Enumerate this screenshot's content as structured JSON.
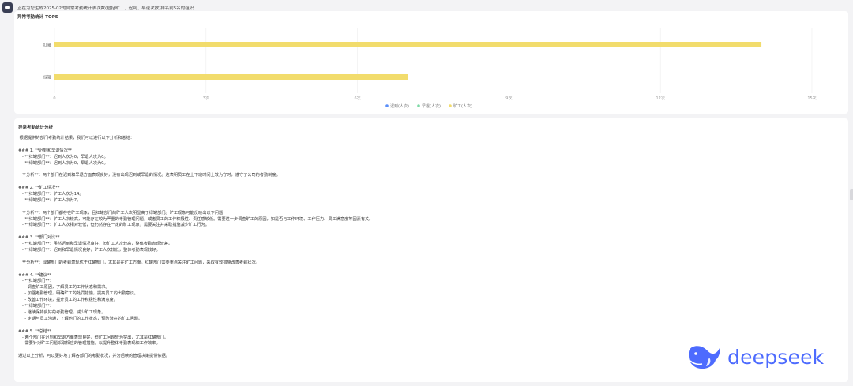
{
  "status": {
    "icon": "bot-eye-icon",
    "text": "正在为您生成2025-02的异常考勤统计表次数(包括旷工、迟到、早退次数)排名前5名的组织..."
  },
  "chart_data": {
    "type": "bar",
    "orientation": "horizontal",
    "title": "异常考勤统计-TOP5",
    "categories": [
      "红罐",
      "绿罐"
    ],
    "series": [
      {
        "name": "迟到(人次)",
        "color": "#5b8ff9",
        "values": [
          0,
          0
        ]
      },
      {
        "name": "早退(人次)",
        "color": "#7ed9a6",
        "values": [
          0,
          0
        ]
      },
      {
        "name": "旷工(人次)",
        "color": "#f2dc6c",
        "values": [
          14,
          7
        ]
      }
    ],
    "xlim": [
      0,
      15
    ],
    "xticks": [
      "0",
      "3次",
      "6次",
      "9次",
      "12次",
      "15次"
    ],
    "grid": true,
    "legend": "bottom-center"
  },
  "analysis": {
    "title": "异常考勤统计分析",
    "lines": [
      " 根据提供的部门考勤统计结果，我们可以进行以下分析和总结：",
      "",
      "### 1. **迟到和早退情况**",
      "   - **红罐部门**：迟到人次为0，早退人次为0。",
      "   - **绿罐部门**：迟到人次为0，早退人次为0。",
      "",
      "   **分析**：两个部门在迟到和早退方面表现良好，没有出现迟到或早退的情况。这表明员工在上下班时间上较为守时，遵守了公司的考勤制度。",
      "",
      "### 2. **旷工情况**",
      "   - **红罐部门**：旷工人次为14。",
      "   - **绿罐部门**：旷工人次为7。",
      "",
      "   **分析**：两个部门都存在旷工现象，且红罐部门的旷工人次明显高于绿罐部门。旷工现象可能反映出以下问题：",
      "   - **红罐部门**：旷工人次较高，可能存在较为严重的考勤管理问题，或者员工的工作积极性、责任感较低。需要进一步调查旷工的原因，如是否与工作环境、工作压力、员工满意度等因素有关。",
      "   - **绿罐部门**：旷工人次相对较低，但仍然存在一定的旷工现象，需要关注并采取措施减少旷工行为。",
      "",
      "### 3. **部门对比**",
      "   - **红罐部门**：虽然迟到和早退情况良好，但旷工人次较高，整体考勤表现较差。",
      "   - **绿罐部门**：迟到和早退情况良好，旷工人次较低，整体考勤表现较好。",
      "",
      "   **分析**：绿罐部门的考勤表现优于红罐部门，尤其是在旷工方面。红罐部门需要重点关注旷工问题，采取有效措施改善考勤状况。",
      "",
      "### 4. **建议**",
      "   - **红罐部门**：",
      "     - 调查旷工原因，了解员工的工作状态和需求。",
      "     - 加强考勤管理，明确旷工的处罚措施，提高员工的出勤意识。",
      "     - 改善工作环境，提升员工的工作积极性和满意度。",
      "   - **绿罐部门**：",
      "     - 继续保持良好的考勤管理，减少旷工现象。",
      "     - 定期与员工沟通，了解他们的工作状态，预防潜在的旷工问题。",
      "",
      "### 5. **总结**",
      "   - 两个部门在迟到和早退方面表现良好，但旷工问题较为突出，尤其是红罐部门。",
      "   - 需要针对旷工问题采取相应的管理措施，以提升整体考勤表现和工作效率。",
      "",
      "通过以上分析，可以更好地了解各部门的考勤状况，并为后续的管理决策提供依据。"
    ]
  },
  "brand": {
    "name": "deepseek",
    "icon": "deepseek-whale-icon",
    "color": "#4d6bfe"
  }
}
